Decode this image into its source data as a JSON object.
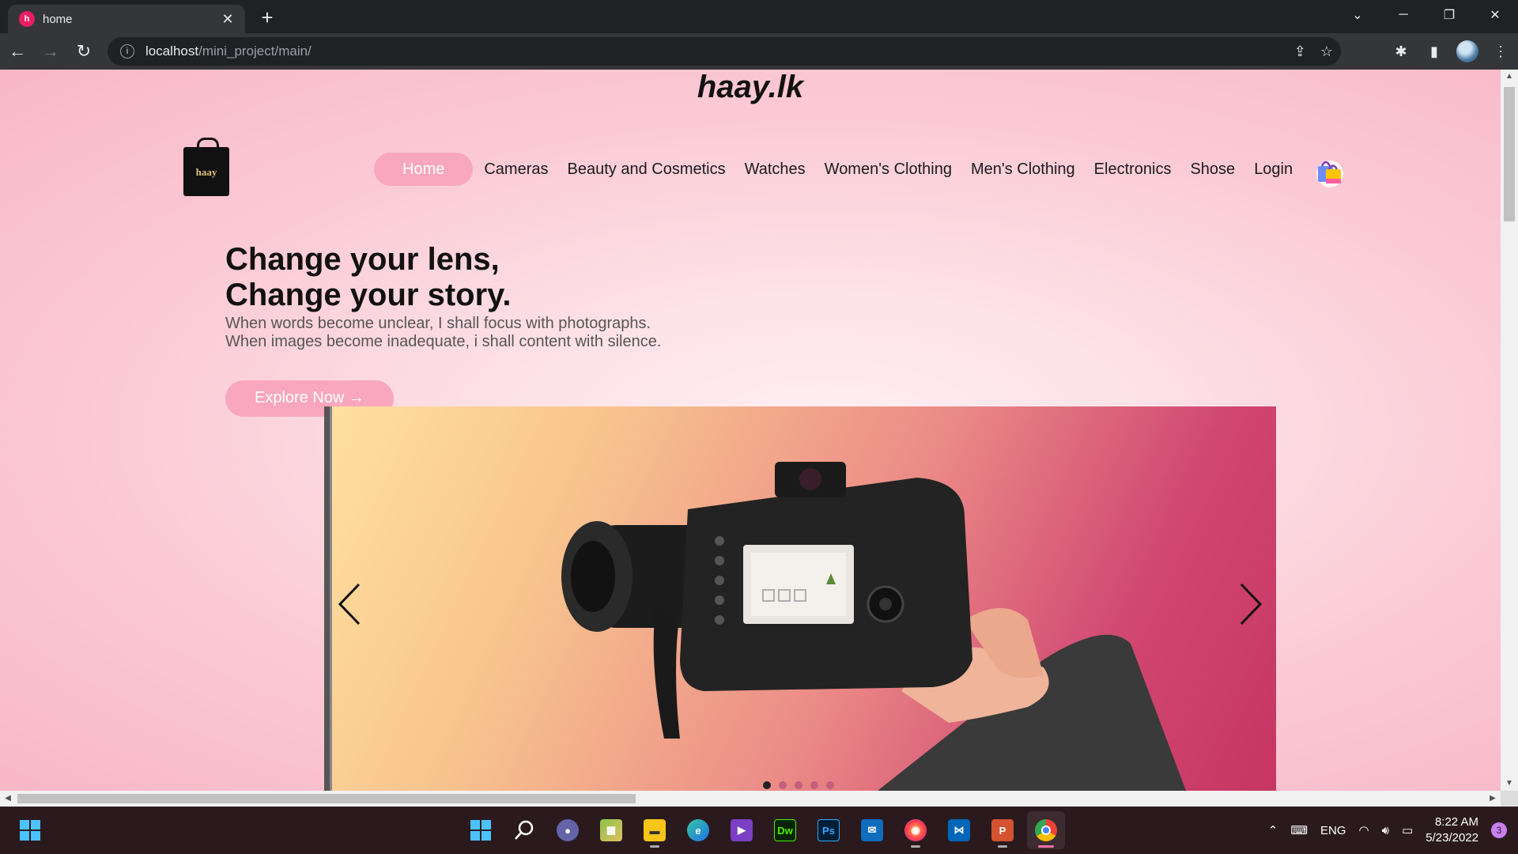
{
  "browser": {
    "tab_title": "home",
    "favicon_letter": "h",
    "url_host": "localhost",
    "url_path": "/mini_project/main/"
  },
  "site": {
    "title": "haay.lk",
    "logo_text": "haay",
    "nav": [
      "Home",
      "Cameras",
      "Beauty and Cosmetics",
      "Watches",
      "Women's Clothing",
      "Men's Clothing",
      "Electronics",
      "Shose",
      "Login"
    ],
    "active_nav": "Home",
    "accent_color": "#f8a7be"
  },
  "hero": {
    "heading_line1": "Change your lens,",
    "heading_line2": "Change your story.",
    "sub_line1": "When words become unclear, I shall focus with photographs.",
    "sub_line2": "When images become inadequate, i shall content with silence.",
    "button_label": "Explore Now →"
  },
  "slider": {
    "slide_count": 5,
    "active_index": 0
  },
  "taskbar": {
    "apps": [
      "windows-start",
      "search",
      "teams-chat",
      "photos",
      "file-explorer",
      "edge",
      "visual-studio",
      "dreamweaver",
      "photoshop",
      "mail",
      "firefox",
      "vscode",
      "powerpoint",
      "chrome"
    ],
    "active_app": "chrome",
    "language": "ENG",
    "time": "8:22 AM",
    "date": "5/23/2022",
    "notification_count": "3"
  }
}
